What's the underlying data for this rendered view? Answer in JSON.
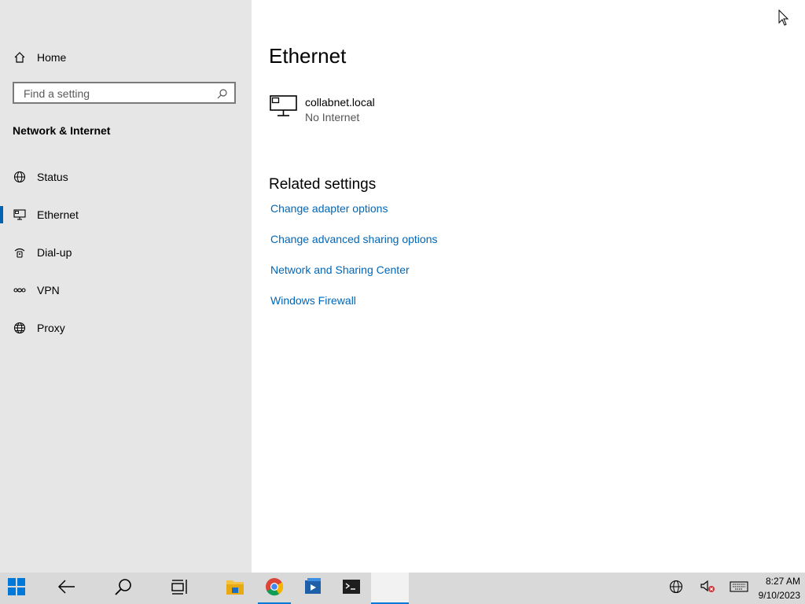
{
  "sidebar": {
    "home_label": "Home",
    "search_placeholder": "Find a setting",
    "section_title": "Network & Internet",
    "items": [
      {
        "label": "Status",
        "icon": "globe-network-icon"
      },
      {
        "label": "Ethernet",
        "icon": "ethernet-icon",
        "selected": true
      },
      {
        "label": "Dial-up",
        "icon": "dialup-icon"
      },
      {
        "label": "VPN",
        "icon": "vpn-icon"
      },
      {
        "label": "Proxy",
        "icon": "globe-icon"
      }
    ]
  },
  "main": {
    "title": "Ethernet",
    "network": {
      "name": "collabnet.local",
      "status": "No Internet"
    },
    "related_title": "Related settings",
    "links": [
      "Change adapter options",
      "Change advanced sharing options",
      "Network and Sharing Center",
      "Windows Firewall"
    ]
  },
  "taskbar": {
    "time": "8:27 AM",
    "date": "9/10/2023"
  },
  "colors": {
    "accent": "#0078d7",
    "link": "#0067b8",
    "sidebar_bg": "#e6e6e6",
    "taskbar_bg": "#d9d9d9"
  }
}
